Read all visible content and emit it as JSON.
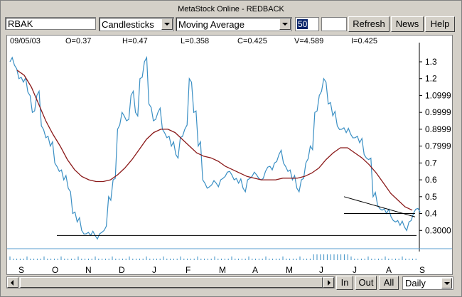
{
  "window": {
    "title": "MetaStock Online - REDBACK"
  },
  "toolbar": {
    "ticker": "RBAK",
    "chart_style": "Candlesticks",
    "indicator": "Moving Average",
    "period": "50",
    "refresh_label": "Refresh",
    "news_label": "News",
    "help_label": "Help"
  },
  "info": {
    "date": "09/05/03",
    "open": "O=0.37",
    "high": "H=0.47",
    "low": "L=0.358",
    "close": "C=0.425",
    "volume": "V=4.589",
    "indicator": "I=0.425"
  },
  "bottom": {
    "in_label": "In",
    "out_label": "Out",
    "all_label": "All",
    "interval": "Daily"
  },
  "colors": {
    "price": "#3a8fc4",
    "moving_average": "#8b1a1a",
    "support_line": "#000000"
  },
  "chart_data": {
    "type": "line",
    "title": "",
    "ylabel": "",
    "ylim": [
      0.2,
      1.38
    ],
    "y_ticks": [
      "1.3",
      "1.2",
      "1.0999",
      "0.9999",
      "0.8999",
      "0.7999",
      "0.7",
      "0.6",
      "0.5",
      "0.4",
      "0.3000"
    ],
    "y_tick_values": [
      1.3,
      1.2,
      1.1,
      1.0,
      0.9,
      0.8,
      0.7,
      0.6,
      0.5,
      0.4,
      0.3
    ],
    "categories": [
      "S",
      "O",
      "N",
      "D",
      "J",
      "F",
      "M",
      "A",
      "M",
      "J",
      "J",
      "A",
      "S"
    ],
    "series": [
      {
        "values": [
          1.3,
          1.28,
          1.2,
          1.18,
          1.12,
          1.0,
          1.1,
          0.92,
          0.85,
          0.8,
          0.7,
          0.65,
          0.6,
          0.55,
          0.4,
          0.35,
          0.3,
          0.28,
          0.27,
          0.27,
          0.28,
          0.3,
          0.5,
          0.6,
          0.9,
          1.0,
          0.95,
          1.1,
          1.0,
          1.2,
          1.3,
          1.05,
          0.95,
          1.0,
          0.9,
          0.85,
          0.8,
          0.75,
          0.85,
          0.9,
          1.2,
          1.0,
          0.8,
          0.6,
          0.55,
          0.57,
          0.58,
          0.6,
          0.62,
          0.65,
          0.6,
          0.58,
          0.55,
          0.6,
          0.62,
          0.63,
          0.6,
          0.65,
          0.68,
          0.7,
          0.75,
          0.7,
          0.65,
          0.6,
          0.55,
          0.6,
          0.7,
          0.8,
          1.0,
          1.1,
          1.2,
          1.05,
          0.98,
          0.92,
          0.9,
          0.88,
          0.87,
          0.85,
          0.82,
          0.75,
          0.72,
          0.5,
          0.45,
          0.42,
          0.4,
          0.38,
          0.35,
          0.33,
          0.32,
          0.35,
          0.4,
          0.43
        ]
      },
      {
        "values": [
          1.25,
          1.22,
          1.15,
          1.05,
          0.95,
          0.87,
          0.8,
          0.72,
          0.66,
          0.62,
          0.6,
          0.59,
          0.59,
          0.6,
          0.63,
          0.67,
          0.72,
          0.78,
          0.84,
          0.88,
          0.9,
          0.9,
          0.88,
          0.84,
          0.8,
          0.76,
          0.74,
          0.73,
          0.71,
          0.68,
          0.66,
          0.64,
          0.62,
          0.61,
          0.6,
          0.6,
          0.6,
          0.61,
          0.61,
          0.61,
          0.62,
          0.64,
          0.67,
          0.72,
          0.76,
          0.79,
          0.79,
          0.76,
          0.73,
          0.69,
          0.64,
          0.58,
          0.52,
          0.48,
          0.44,
          0.42
        ]
      }
    ],
    "grid": false,
    "legend": "none"
  }
}
